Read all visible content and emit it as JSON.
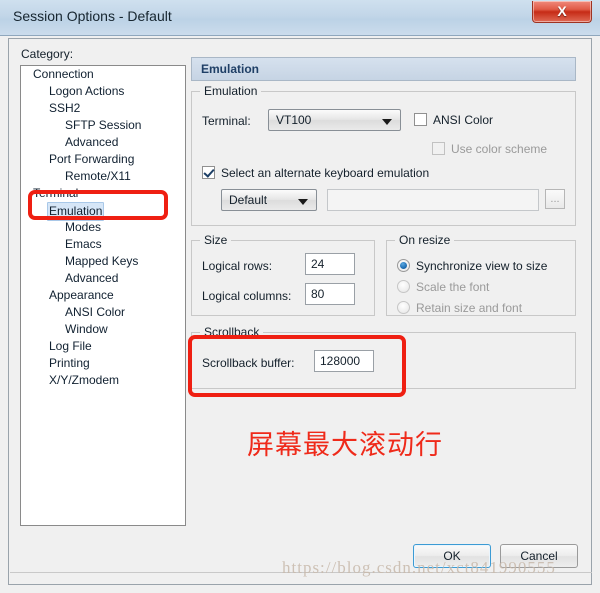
{
  "window": {
    "title": "Session Options - Default",
    "close_label": "X"
  },
  "sidebar": {
    "label": "Category:",
    "items": [
      {
        "label": "Connection",
        "indent": 0,
        "expander": "expanded"
      },
      {
        "label": "Logon Actions",
        "indent": 1,
        "expander": "none"
      },
      {
        "label": "SSH2",
        "indent": 1,
        "expander": "expanded"
      },
      {
        "label": "SFTP Session",
        "indent": 2,
        "expander": "none"
      },
      {
        "label": "Advanced",
        "indent": 2,
        "expander": "none"
      },
      {
        "label": "Port Forwarding",
        "indent": 1,
        "expander": "expanded"
      },
      {
        "label": "Remote/X11",
        "indent": 2,
        "expander": "none"
      },
      {
        "label": "Terminal",
        "indent": 0,
        "expander": "expanded"
      },
      {
        "label": "Emulation",
        "indent": 1,
        "expander": "expanded",
        "selected": true
      },
      {
        "label": "Modes",
        "indent": 2,
        "expander": "none"
      },
      {
        "label": "Emacs",
        "indent": 2,
        "expander": "none"
      },
      {
        "label": "Mapped Keys",
        "indent": 2,
        "expander": "none"
      },
      {
        "label": "Advanced",
        "indent": 2,
        "expander": "none"
      },
      {
        "label": "Appearance",
        "indent": 1,
        "expander": "expanded"
      },
      {
        "label": "ANSI Color",
        "indent": 2,
        "expander": "none"
      },
      {
        "label": "Window",
        "indent": 2,
        "expander": "none"
      },
      {
        "label": "Log File",
        "indent": 1,
        "expander": "none"
      },
      {
        "label": "Printing",
        "indent": 1,
        "expander": "none"
      },
      {
        "label": "X/Y/Zmodem",
        "indent": 1,
        "expander": "none"
      }
    ]
  },
  "panel": {
    "header": "Emulation",
    "emulation_group": {
      "title": "Emulation",
      "terminal_label": "Terminal:",
      "terminal_value": "VT100",
      "ansi_color_label": "ANSI Color",
      "ansi_color_checked": false,
      "use_color_scheme_label": "Use color scheme",
      "use_color_scheme_checked": false,
      "alt_keyboard_label": "Select an alternate keyboard emulation",
      "alt_keyboard_checked": true,
      "keymap_value": "Default",
      "keymap_file_value": "",
      "browse_label": "..."
    },
    "size_group": {
      "title": "Size",
      "rows_label": "Logical rows:",
      "rows_value": "24",
      "cols_label": "Logical columns:",
      "cols_value": "80"
    },
    "resize_group": {
      "title": "On resize",
      "options": [
        {
          "label": "Synchronize view to size",
          "selected": true,
          "disabled": false
        },
        {
          "label": "Scale the font",
          "selected": false,
          "disabled": true
        },
        {
          "label": "Retain size and font",
          "selected": false,
          "disabled": true
        }
      ]
    },
    "scrollback_group": {
      "title": "Scrollback",
      "buffer_label": "Scrollback buffer:",
      "buffer_value": "128000"
    }
  },
  "footer": {
    "ok_label": "OK",
    "cancel_label": "Cancel"
  },
  "annotations": {
    "note_text": "屏幕最大滚动行",
    "note_color": "#ef2a1a",
    "box_color": "#ef1f12",
    "watermark": "https://blog.csdn.net/xct841990555"
  }
}
